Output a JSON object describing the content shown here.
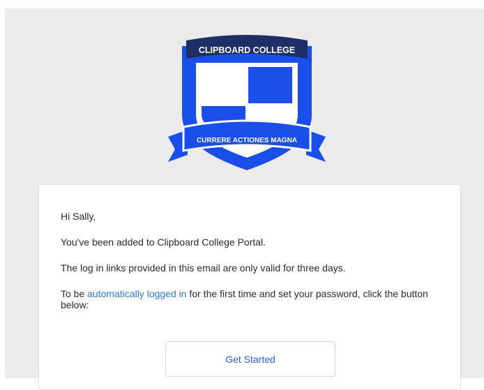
{
  "crest": {
    "top_banner": "CLIPBOARD COLLEGE",
    "motto_banner": "CURRERE ACTIONES MAGNA",
    "colors": {
      "primary": "#1a4ee8",
      "navy": "#1e2f66",
      "white": "#ffffff"
    }
  },
  "email": {
    "greeting": "Hi Sally,",
    "added_line": "You've been added to Clipboard College Portal.",
    "validity_line": "The log in links provided in this email are only valid for three days.",
    "login_prefix": "To be ",
    "login_link": "automatically logged in",
    "login_suffix": " for the first time and set your password, click the button below:",
    "button_label": "Get Started"
  }
}
